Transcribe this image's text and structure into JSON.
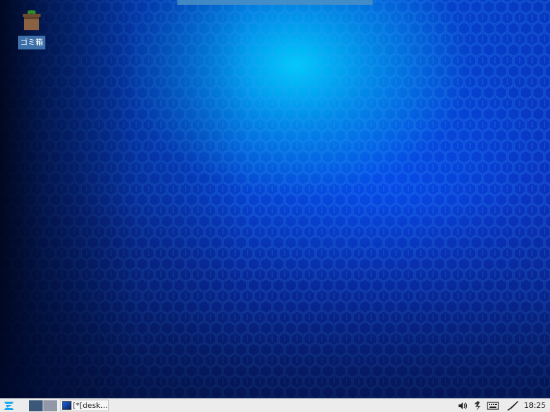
{
  "desktop": {
    "wallpaper": {
      "description_colors": {
        "glow": "#00d2ff",
        "base": "#0a2fa0",
        "dark": "#000519",
        "hex_lines": "#3aa0ff"
      }
    },
    "icons": [
      {
        "name": "trash",
        "label": "ゴミ箱",
        "icon": "trash-icon"
      }
    ]
  },
  "taskbar": {
    "start": {
      "icon": "zorin-logo-icon",
      "color": "#15a6f0"
    },
    "workspaces": [
      {
        "id": 1,
        "active": true,
        "color": "#3b5779"
      },
      {
        "id": 2,
        "active": false,
        "color": "#9198a8"
      }
    ],
    "tasks": [
      {
        "title": "[*[desk…",
        "icon": "image-icon"
      }
    ],
    "tray": {
      "icons": [
        "volume-icon",
        "network-icon",
        "keyboard-icon",
        "pen-icon"
      ]
    },
    "clock": "18:25"
  }
}
